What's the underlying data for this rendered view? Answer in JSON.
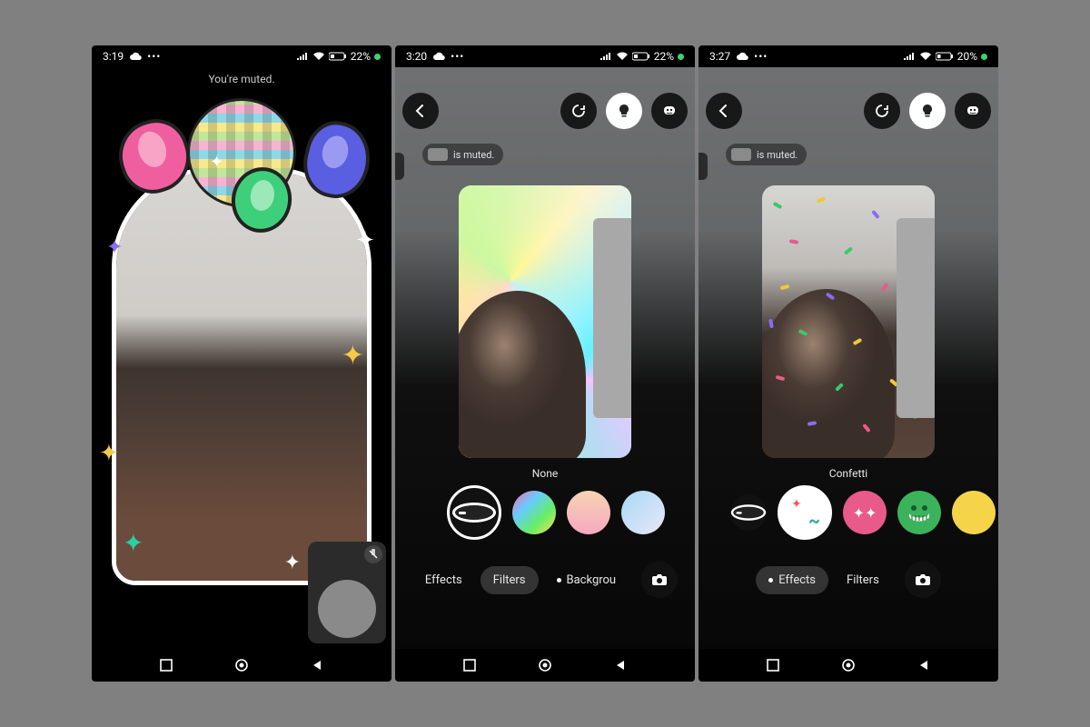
{
  "screens": [
    {
      "statusbar": {
        "time": "3:19",
        "battery": "22%"
      },
      "muted_text": "You're muted."
    },
    {
      "statusbar": {
        "time": "3:20",
        "battery": "22%"
      },
      "muted_pill_text": "is muted.",
      "filter_label": "None",
      "tabs": {
        "effects": "Effects",
        "filters": "Filters",
        "backgrounds": "Backgrou",
        "active": "filters",
        "dot_on": "backgrounds"
      }
    },
    {
      "statusbar": {
        "time": "3:27",
        "battery": "20%"
      },
      "muted_pill_text": "is muted.",
      "filter_label": "Confetti",
      "tabs": {
        "effects": "Effects",
        "filters": "Filters",
        "active": "effects",
        "dot_on": "effects"
      }
    }
  ]
}
